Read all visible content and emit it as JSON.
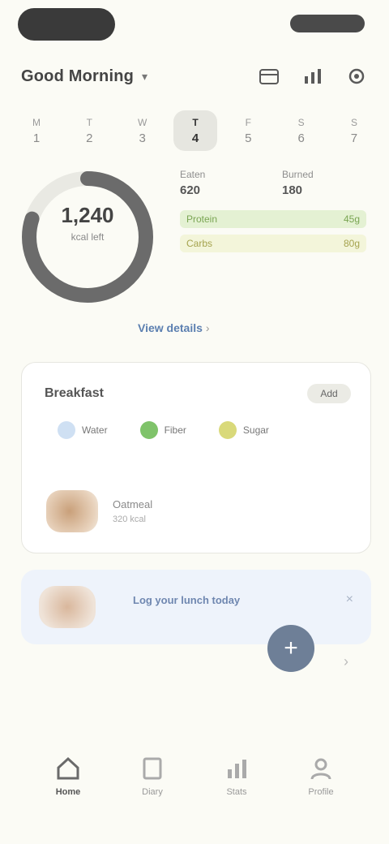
{
  "header": {
    "title": "Good Morning",
    "chevron_icon": "chevron-down-icon",
    "icons": [
      "calendar-icon",
      "chart-icon",
      "settings-icon"
    ]
  },
  "week": {
    "days": [
      {
        "name": "M",
        "date": "1"
      },
      {
        "name": "T",
        "date": "2"
      },
      {
        "name": "W",
        "date": "3"
      },
      {
        "name": "T",
        "date": "4",
        "active": true
      },
      {
        "name": "F",
        "date": "5"
      },
      {
        "name": "S",
        "date": "6"
      },
      {
        "name": "S",
        "date": "7"
      }
    ]
  },
  "ring": {
    "value": "1,240",
    "label": "kcal left",
    "progress": 0.8,
    "color": "#6b6b6b"
  },
  "stats": {
    "eaten_label": "Eaten",
    "eaten_value": "620",
    "burned_label": "Burned",
    "burned_value": "180",
    "macros": [
      {
        "label": "Protein",
        "value": "45g",
        "color": "#e4f1d3",
        "text": "#7aa553"
      },
      {
        "label": "Carbs",
        "value": "80g",
        "color": "#f3f5da",
        "text": "#a5a34e"
      }
    ]
  },
  "link": {
    "label": "View details",
    "tail": "›"
  },
  "card": {
    "title": "Breakfast",
    "button": "Add",
    "chips": [
      {
        "label": "Water",
        "color": "#cfe0f3"
      },
      {
        "label": "Fiber",
        "color": "#7fc36a"
      },
      {
        "label": "Sugar",
        "color": "#d9d97a"
      }
    ],
    "meal": {
      "name": "Oatmeal",
      "sub": "320 kcal"
    }
  },
  "banner": {
    "text": "Log your lunch today",
    "close": "×"
  },
  "fab": {
    "label": "+"
  },
  "tabbar": {
    "tabs": [
      {
        "label": "Home",
        "icon": "home-icon",
        "active": true
      },
      {
        "label": "Diary",
        "icon": "book-icon"
      },
      {
        "label": "Stats",
        "icon": "chart-icon"
      },
      {
        "label": "Profile",
        "icon": "user-icon"
      }
    ]
  }
}
